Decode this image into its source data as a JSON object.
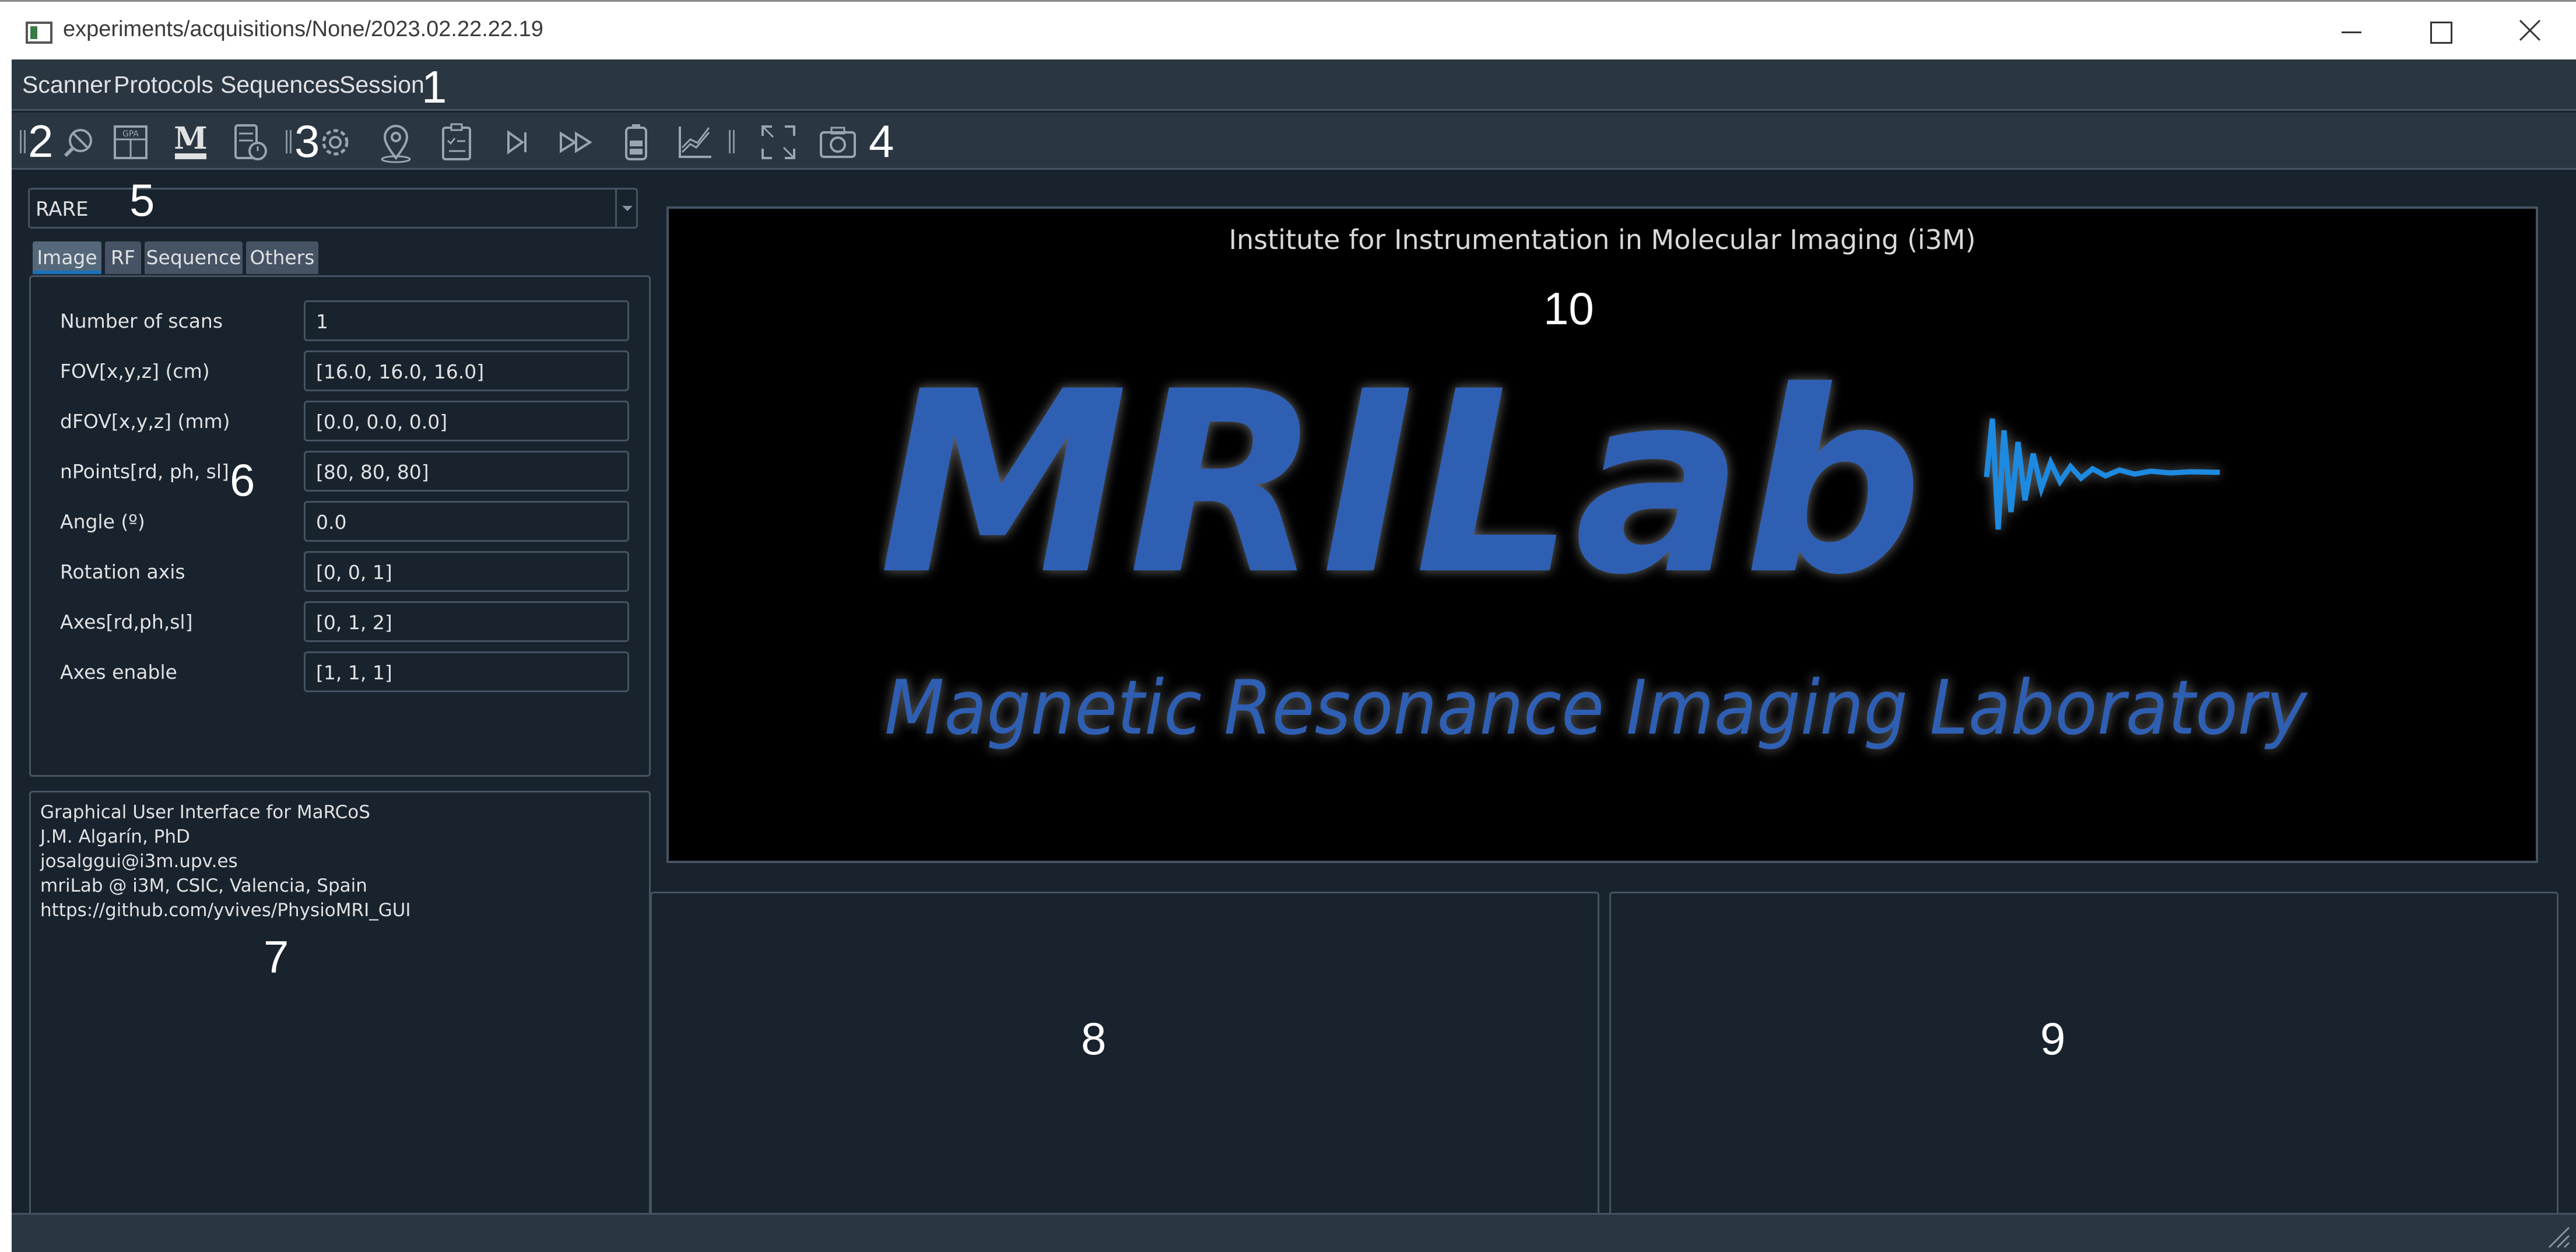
{
  "window": {
    "title": "experiments/acquisitions/None/2023.02.22.22.19"
  },
  "menu": {
    "items": [
      "Scanner",
      "Protocols",
      "Sequences",
      "Session"
    ]
  },
  "markers": [
    "1",
    "2",
    "3",
    "4",
    "5",
    "6",
    "7",
    "8",
    "9",
    "10"
  ],
  "toolbar": {
    "icons": [
      "search-off-icon",
      "gpa-fhdo-icon",
      "marcos-icon",
      "server-timer-icon",
      "settings-icon",
      "localizer-icon",
      "checklist-icon",
      "step-forward-icon",
      "fast-forward-icon",
      "battery-icon",
      "plot-view-icon",
      "fullscreen-icon",
      "camera-icon"
    ]
  },
  "sequence_selector": {
    "value": "RARE"
  },
  "tabs": [
    "Image",
    "RF",
    "Sequence",
    "Others"
  ],
  "parameters": [
    {
      "label": "Number of scans",
      "value": "1"
    },
    {
      "label": "FOV[x,y,z] (cm)",
      "value": "[16.0, 16.0, 16.0]"
    },
    {
      "label": "dFOV[x,y,z] (mm)",
      "value": "[0.0, 0.0, 0.0]"
    },
    {
      "label": "nPoints[rd, ph, sl]",
      "value": "[80, 80, 80]"
    },
    {
      "label": "Angle (º)",
      "value": "0.0"
    },
    {
      "label": "Rotation axis",
      "value": "[0, 0, 1]"
    },
    {
      "label": "Axes[rd,ph,sl]",
      "value": "[0, 1, 2]"
    },
    {
      "label": "Axes enable",
      "value": "[1, 1, 1]"
    }
  ],
  "info": [
    "Graphical User Interface for MaRCoS",
    "J.M. Algarín, PhD",
    "josalggui@i3m.upv.es",
    "mriLab @ i3M, CSIC, Valencia, Spain",
    "https://github.com/yvives/PhysioMRI_GUI"
  ],
  "splash": {
    "institute": "Institute for Instrumentation in Molecular Imaging (i3M)",
    "logo_title": "MRILab",
    "logo_subtitle": "Magnetic Resonance Imaging Laboratory",
    "logo_color": "#2f5fb3"
  },
  "colors": {
    "background": "#19232d",
    "panel": "#2a3642",
    "border": "#455364",
    "accent": "#1a72bb"
  }
}
